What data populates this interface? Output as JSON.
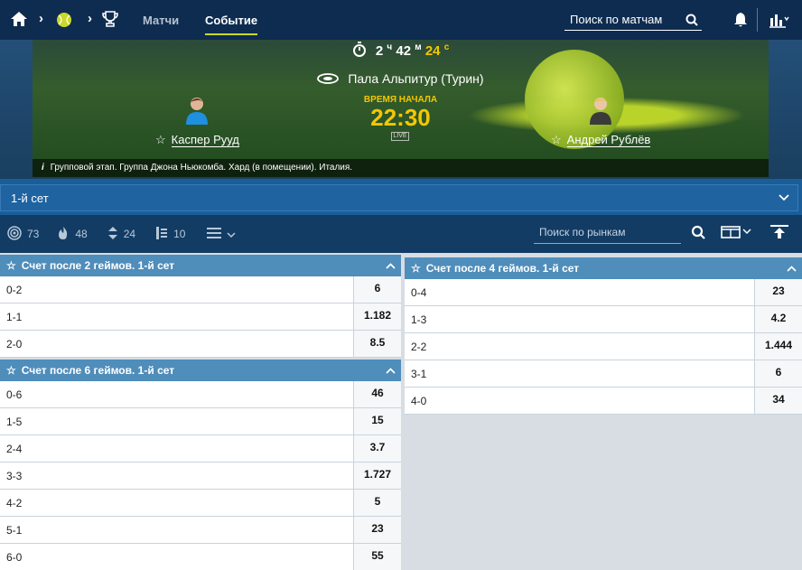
{
  "nav": {
    "tabs": [
      {
        "label": "Матчи",
        "active": false
      },
      {
        "label": "Событие",
        "active": true
      }
    ],
    "search_placeholder": "Поиск по матчам",
    "icons": [
      "home-icon",
      "tennis-ball-icon",
      "trophy-icon",
      "search-icon",
      "bell-icon",
      "stats-icon"
    ]
  },
  "event": {
    "countdown": {
      "hours": "2",
      "h_unit": "ч",
      "minutes": "42",
      "m_unit": "м",
      "seconds": "24",
      "s_unit": "с"
    },
    "venue": "Пала Альпитур (Турин)",
    "start_label": "ВРЕМЯ НАЧАЛА",
    "start_time": "22:30",
    "live_badge": "LIVE",
    "home": {
      "name": "Каспер Рууд"
    },
    "away": {
      "name": "Андрей Рублёв"
    },
    "info": "Групповой этап. Группа Джона Ньюкомба. Хард (в помещении). Италия."
  },
  "set_selector": {
    "label": "1-й сет"
  },
  "filters": {
    "items": [
      {
        "icon": "all-markets-icon",
        "count": "73"
      },
      {
        "icon": "fire-icon",
        "count": "48"
      },
      {
        "icon": "handicap-icon",
        "count": "24"
      },
      {
        "icon": "totals-icon",
        "count": "10"
      }
    ],
    "search_placeholder": "Поиск по рынкам"
  },
  "markets_left": [
    {
      "title": "Счет после 2 геймов. 1-й сет",
      "rows": [
        {
          "label": "0-2",
          "odd": "6"
        },
        {
          "label": "1-1",
          "odd": "1.182"
        },
        {
          "label": "2-0",
          "odd": "8.5"
        }
      ]
    },
    {
      "title": "Счет после 6 геймов. 1-й сет",
      "rows": [
        {
          "label": "0-6",
          "odd": "46"
        },
        {
          "label": "1-5",
          "odd": "15"
        },
        {
          "label": "2-4",
          "odd": "3.7"
        },
        {
          "label": "3-3",
          "odd": "1.727"
        },
        {
          "label": "4-2",
          "odd": "5"
        },
        {
          "label": "5-1",
          "odd": "23"
        },
        {
          "label": "6-0",
          "odd": "55"
        }
      ]
    }
  ],
  "markets_right": [
    {
      "title": "Счет после 4 геймов. 1-й сет",
      "rows": [
        {
          "label": "0-4",
          "odd": "23"
        },
        {
          "label": "1-3",
          "odd": "4.2"
        },
        {
          "label": "2-2",
          "odd": "1.444"
        },
        {
          "label": "3-1",
          "odd": "6"
        },
        {
          "label": "4-0",
          "odd": "34"
        }
      ]
    }
  ]
}
